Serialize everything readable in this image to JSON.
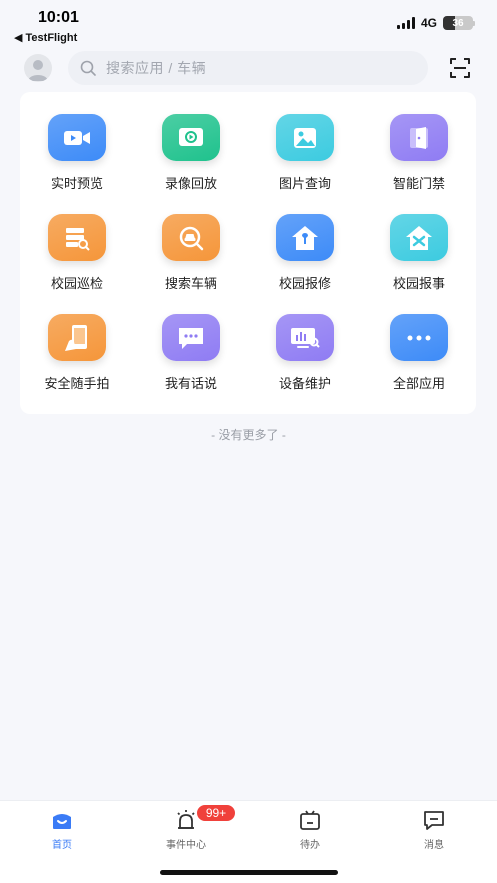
{
  "status": {
    "time": "10:01",
    "back_app": "◀ TestFlight",
    "network": "4G",
    "battery": "36"
  },
  "search": {
    "placeholder": "搜索应用 / 车辆"
  },
  "apps": [
    {
      "label": "实时预览",
      "icon": "video-camera-icon",
      "color": "#3d8bf8"
    },
    {
      "label": "录像回放",
      "icon": "playback-icon",
      "color": "#1fc28d"
    },
    {
      "label": "图片查询",
      "icon": "image-icon",
      "color": "#3ccbe0"
    },
    {
      "label": "智能门禁",
      "icon": "door-icon",
      "color": "#8f7cf3"
    },
    {
      "label": "校园巡检",
      "icon": "inspection-icon",
      "color": "#f5963a"
    },
    {
      "label": "搜索车辆",
      "icon": "car-search-icon",
      "color": "#f5963a"
    },
    {
      "label": "校园报修",
      "icon": "repair-house-icon",
      "color": "#3d8bf8"
    },
    {
      "label": "校园报事",
      "icon": "report-house-icon",
      "color": "#3ccbe0"
    },
    {
      "label": "安全随手拍",
      "icon": "phone-camera-icon",
      "color": "#f5963a"
    },
    {
      "label": "我有话说",
      "icon": "chat-icon",
      "color": "#8f7cf3"
    },
    {
      "label": "设备维护",
      "icon": "device-maintenance-icon",
      "color": "#8f7cf3"
    },
    {
      "label": "全部应用",
      "icon": "more-icon",
      "color": "#3d8bf8"
    }
  ],
  "no_more": "- 没有更多了 -",
  "tabs": [
    {
      "label": "首页",
      "icon": "home-icon",
      "active": true
    },
    {
      "label": "事件中心",
      "icon": "alarm-icon",
      "active": false
    },
    {
      "label": "待办",
      "icon": "todo-icon",
      "active": false
    },
    {
      "label": "消息",
      "icon": "message-icon",
      "active": false
    }
  ],
  "event_badge": "99+",
  "colors": {
    "accent": "#3a7bf6",
    "badge": "#f0413b"
  }
}
